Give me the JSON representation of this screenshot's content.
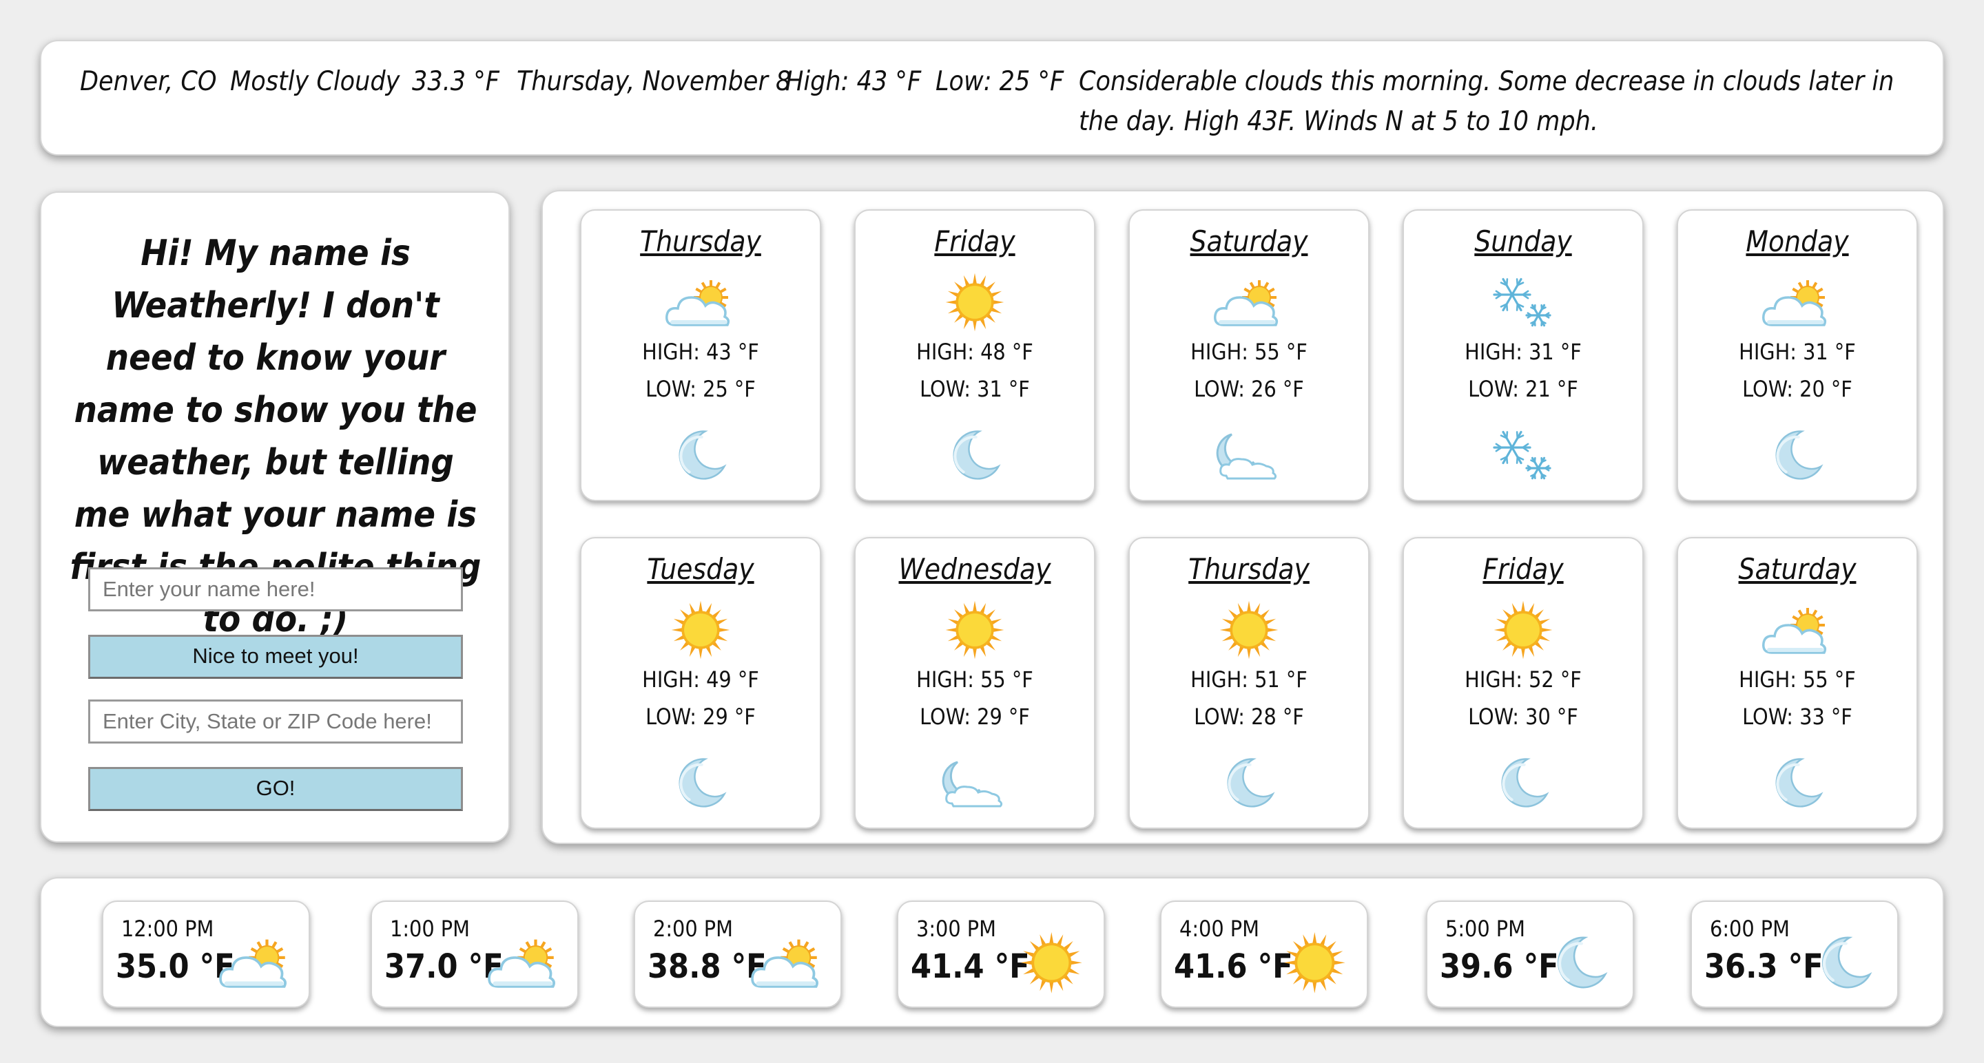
{
  "current": {
    "location": "Denver, CO",
    "condition": "Mostly Cloudy",
    "temperature": "33.3 °F",
    "date": "Thursday, November 8",
    "high": "High: 43 °F",
    "low": "Low: 25 °F",
    "description": "Considerable clouds this morning. Some decrease in clouds later in the day. High 43F. Winds N at 5 to 10 mph."
  },
  "intro": {
    "greeting": "Hi! My name is Weatherly! I don't need to know your name to show you the weather, but telling me what your name is first is the polite thing to do. ;)",
    "name_placeholder": "Enter your name here!",
    "name_button": "Nice to meet you!",
    "city_placeholder": "Enter City, State or ZIP Code here!",
    "city_button": "GO!"
  },
  "forecast": [
    {
      "day": "Thursday",
      "high": "HIGH: 43 °F",
      "low": "LOW: 25 °F",
      "day_icon": "partly-cloudy-icon",
      "night_icon": "moon-icon"
    },
    {
      "day": "Friday",
      "high": "HIGH: 48 °F",
      "low": "LOW: 31 °F",
      "day_icon": "sun-icon",
      "night_icon": "moon-icon"
    },
    {
      "day": "Saturday",
      "high": "HIGH: 55 °F",
      "low": "LOW: 26 °F",
      "day_icon": "partly-cloudy-icon",
      "night_icon": "night-cloudy-icon"
    },
    {
      "day": "Sunday",
      "high": "HIGH: 31 °F",
      "low": "LOW: 21 °F",
      "day_icon": "snow-icon",
      "night_icon": "snow-icon"
    },
    {
      "day": "Monday",
      "high": "HIGH: 31 °F",
      "low": "LOW: 20 °F",
      "day_icon": "partly-cloudy-icon",
      "night_icon": "moon-icon"
    },
    {
      "day": "Tuesday",
      "high": "HIGH: 49 °F",
      "low": "LOW: 29 °F",
      "day_icon": "sun-icon",
      "night_icon": "moon-icon"
    },
    {
      "day": "Wednesday",
      "high": "HIGH: 55 °F",
      "low": "LOW: 29 °F",
      "day_icon": "sun-icon",
      "night_icon": "night-cloudy-icon"
    },
    {
      "day": "Thursday",
      "high": "HIGH: 51 °F",
      "low": "LOW: 28 °F",
      "day_icon": "sun-icon",
      "night_icon": "moon-icon"
    },
    {
      "day": "Friday",
      "high": "HIGH: 52 °F",
      "low": "LOW: 30 °F",
      "day_icon": "sun-icon",
      "night_icon": "moon-icon"
    },
    {
      "day": "Saturday",
      "high": "HIGH: 55 °F",
      "low": "LOW: 33 °F",
      "day_icon": "partly-cloudy-icon",
      "night_icon": "moon-icon"
    }
  ],
  "hourly": [
    {
      "time": "12:00 PM",
      "temp": "35.0 °F",
      "icon": "partly-cloudy-icon"
    },
    {
      "time": "1:00 PM",
      "temp": "37.0 °F",
      "icon": "partly-cloudy-icon"
    },
    {
      "time": "2:00 PM",
      "temp": "38.8 °F",
      "icon": "partly-cloudy-icon"
    },
    {
      "time": "3:00 PM",
      "temp": "41.4 °F",
      "icon": "sun-icon"
    },
    {
      "time": "4:00 PM",
      "temp": "41.6 °F",
      "icon": "sun-icon"
    },
    {
      "time": "5:00 PM",
      "temp": "39.6 °F",
      "icon": "moon-icon"
    },
    {
      "time": "6:00 PM",
      "temp": "36.3 °F",
      "icon": "moon-icon"
    }
  ],
  "colors": {
    "button_bg": "#add8e6",
    "sun": "#f7c21e",
    "cloud": "#bfe3f2",
    "moon": "#bfe0ef"
  }
}
